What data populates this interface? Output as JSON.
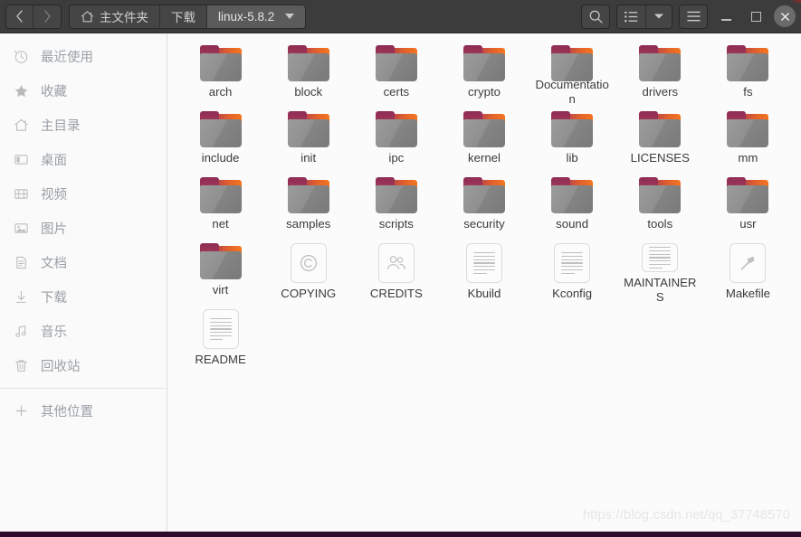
{
  "window": {
    "title": "linux-5.8.2",
    "nav": {
      "back_label": "‹",
      "forward_label": "›"
    },
    "path_segments": [
      {
        "label": "主文件夹",
        "icon": "home-icon",
        "current": false
      },
      {
        "label": "下载",
        "icon": "",
        "current": false
      },
      {
        "label": "linux-5.8.2",
        "icon": "",
        "current": true
      }
    ],
    "toolbar": {
      "search_label": "search-icon",
      "view_list_label": "list-view-icon",
      "view_dropdown_label": "chevron-down-icon",
      "menu_label": "hamburger-menu-icon"
    },
    "controls": {
      "minimize_label": "minimize",
      "maximize_label": "maximize",
      "close_label": "×"
    },
    "accent_dark": "#3c3c3c",
    "accent_folder": "#f4761f",
    "bottom_bar_color": "#2d0a2e"
  },
  "sidebar": {
    "items": [
      {
        "label": "最近使用",
        "icon": "clock-icon"
      },
      {
        "label": "收藏",
        "icon": "star-icon"
      },
      {
        "label": "主目录",
        "icon": "home-icon"
      },
      {
        "label": "桌面",
        "icon": "desktop-icon"
      },
      {
        "label": "视频",
        "icon": "film-icon"
      },
      {
        "label": "图片",
        "icon": "image-icon"
      },
      {
        "label": "文档",
        "icon": "document-icon"
      },
      {
        "label": "下载",
        "icon": "download-icon"
      },
      {
        "label": "音乐",
        "icon": "music-icon"
      },
      {
        "label": "回收站",
        "icon": "trash-icon"
      }
    ],
    "other_locations": {
      "label": "其他位置",
      "icon": "plus-icon"
    }
  },
  "files": [
    {
      "name": "arch",
      "type": "folder"
    },
    {
      "name": "block",
      "type": "folder"
    },
    {
      "name": "certs",
      "type": "folder"
    },
    {
      "name": "crypto",
      "type": "folder"
    },
    {
      "name": "Documentation",
      "type": "folder"
    },
    {
      "name": "drivers",
      "type": "folder"
    },
    {
      "name": "fs",
      "type": "folder"
    },
    {
      "name": "include",
      "type": "folder"
    },
    {
      "name": "init",
      "type": "folder"
    },
    {
      "name": "ipc",
      "type": "folder"
    },
    {
      "name": "kernel",
      "type": "folder"
    },
    {
      "name": "lib",
      "type": "folder"
    },
    {
      "name": "LICENSES",
      "type": "folder"
    },
    {
      "name": "mm",
      "type": "folder"
    },
    {
      "name": "net",
      "type": "folder"
    },
    {
      "name": "samples",
      "type": "folder"
    },
    {
      "name": "scripts",
      "type": "folder"
    },
    {
      "name": "security",
      "type": "folder"
    },
    {
      "name": "sound",
      "type": "folder"
    },
    {
      "name": "tools",
      "type": "folder"
    },
    {
      "name": "usr",
      "type": "folder"
    },
    {
      "name": "virt",
      "type": "folder"
    },
    {
      "name": "COPYING",
      "type": "file",
      "icon": "copyright-icon"
    },
    {
      "name": "CREDITS",
      "type": "file",
      "icon": "people-icon"
    },
    {
      "name": "Kbuild",
      "type": "file",
      "icon": "text-icon"
    },
    {
      "name": "Kconfig",
      "type": "file",
      "icon": "text-icon"
    },
    {
      "name": "MAINTAINERS",
      "type": "file",
      "icon": "text-icon"
    },
    {
      "name": "Makefile",
      "type": "file",
      "icon": "hammer-icon"
    },
    {
      "name": "README",
      "type": "file",
      "icon": "text-icon"
    }
  ],
  "watermark": {
    "text": "https://blog.csdn.net/qq_37748570"
  }
}
